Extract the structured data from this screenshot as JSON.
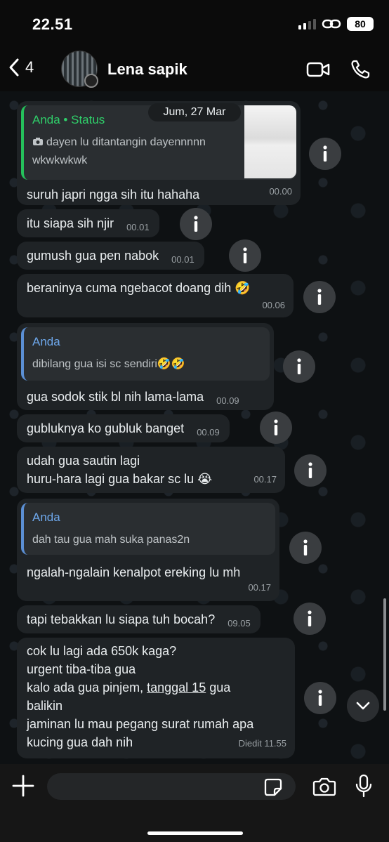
{
  "status_bar": {
    "time": "22.51",
    "battery": "80"
  },
  "header": {
    "back_count": "4",
    "contact_name": "Lena sapik"
  },
  "chat": {
    "date_chip": "Jum, 27 Mar",
    "messages": [
      {
        "quote": {
          "author": "Anda • Status",
          "text": "dayen lu ditantangin dayennnnn wkwkwkwk"
        },
        "text": "suruh japri ngga sih itu hahaha",
        "time": "00.00"
      },
      {
        "text": "itu siapa sih njir",
        "time": "00.01"
      },
      {
        "text": "gumush gua pen nabok",
        "time": "00.01"
      },
      {
        "text": "beraninya cuma ngebacot doang dih 🤣",
        "time": "00.06"
      },
      {
        "quote": {
          "author": "Anda",
          "text": "dibilang gua isi sc sendiri🤣🤣"
        },
        "text": "gua sodok stik bl nih lama-lama",
        "time": "00.09"
      },
      {
        "text": "gubluknya ko gubluk banget",
        "time": "00.09"
      },
      {
        "lines": [
          "udah gua sautin lagi",
          "huru-hara lagi gua bakar sc lu 😭"
        ],
        "time": "00.17"
      },
      {
        "quote": {
          "author": "Anda",
          "text": "dah tau gua mah suka panas2n"
        },
        "text": "ngalah-ngalain kenalpot ereking lu mh",
        "time": "00.17"
      },
      {
        "text": "tapi tebakkan lu siapa tuh bocah?",
        "time": "09.05"
      },
      {
        "lines": [
          "cok lu lagi ada 650k kaga?",
          "urgent tiba-tiba gua",
          "kalo ada gua pinjem, ",
          "balikin",
          "jaminan lu mau pegang surat rumah apa",
          "kucing gua dah nih"
        ],
        "underlined": "tanggal 15",
        "after_underline": " gua",
        "time": "Diedit 11.55"
      }
    ]
  },
  "composer": {
    "placeholder": ""
  },
  "icons": {
    "back": "chevron-left-icon",
    "video": "video-camera-icon",
    "phone": "phone-icon",
    "info": "info-icon",
    "scroll_down": "chevron-down-icon",
    "plus": "plus-icon",
    "sticker": "sticker-icon",
    "camera": "camera-icon",
    "mic": "microphone-icon"
  }
}
